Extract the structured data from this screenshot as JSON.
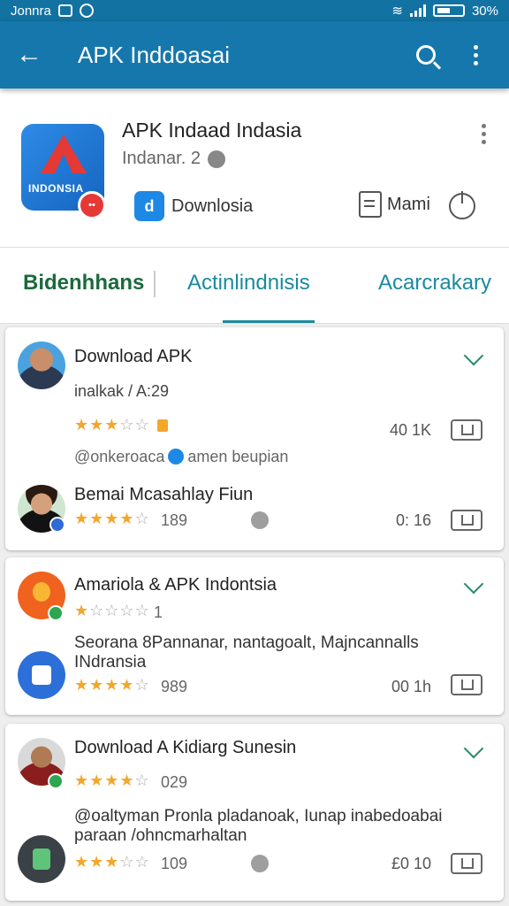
{
  "status_bar": {
    "carrier": "Jonnra",
    "battery": "30%"
  },
  "app_bar": {
    "title": "APK Inddoasai"
  },
  "app_header": {
    "logo_text": "INDONSIA",
    "name": "APK Indaad Indasia",
    "subtitle": "Indanar. 2",
    "download_label": "Downlosia",
    "menu_label": "Mami"
  },
  "tabs": [
    {
      "label": "Bidenhhans"
    },
    {
      "label": "Actinlindnisis"
    },
    {
      "label": "Acarcrakary"
    }
  ],
  "cards": [
    {
      "title": "Download APK",
      "meta": "inalkak / A:29",
      "rating": 3.5,
      "count": "40 1K",
      "handle_text": "@onkeroaca",
      "handle_suffix": "amen beupian",
      "second_title": "Bemai Mcasahlay Fiun",
      "second_rating": 4,
      "second_reviews": "189",
      "second_count": "0: 16"
    },
    {
      "title": "Amariola & APK Indontsia",
      "rating": 1,
      "reviews": "1",
      "body": "Seorana 8Pannanar, nantagoalt, Majncannalls INdransia",
      "second_rating": 4,
      "second_reviews": "989",
      "second_count": "00 1h"
    },
    {
      "title": "Download A Kidiarg Sunesin",
      "rating": 4,
      "reviews": "029",
      "body": "@oaltyman Pronla pladanoak, Iunap inabedoabai paraan /ohncmarhaltan",
      "second_rating": 3.5,
      "second_reviews": "109",
      "second_count": "£0 10"
    }
  ],
  "colors": {
    "app_bar": "#1677ac",
    "accent_tab": "#1a8a9e",
    "active_tab": "#1b6a3c",
    "star": "#f2a72c"
  },
  "icons": [
    "back-arrow-icon",
    "search-icon",
    "more-vert-icon",
    "download-icon",
    "message-icon",
    "power-icon",
    "chevron-down-icon",
    "verified-icon",
    "folder-icon"
  ]
}
